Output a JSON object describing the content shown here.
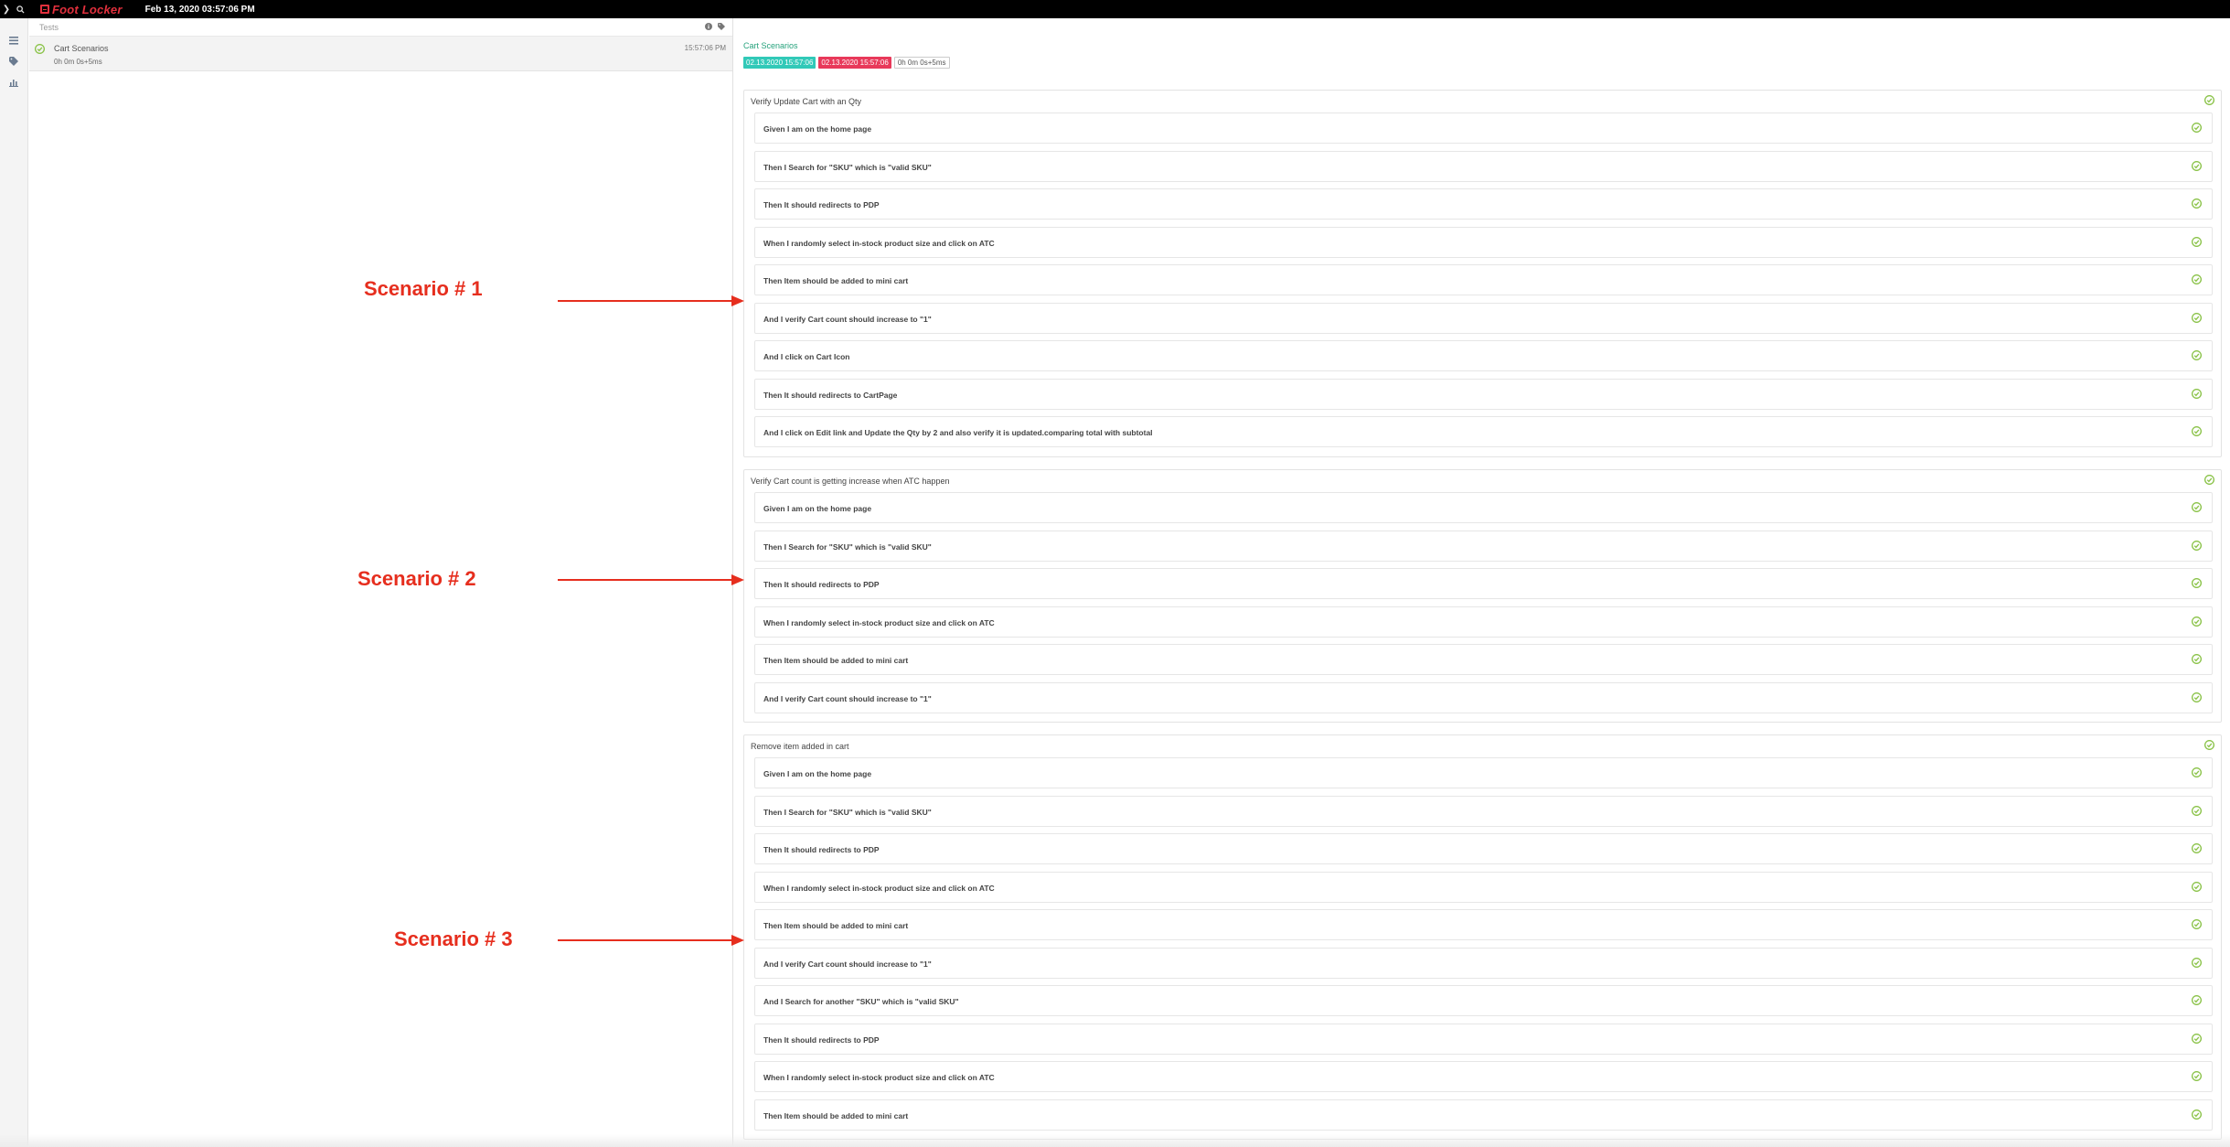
{
  "topbar": {
    "brand": "Foot Locker",
    "report_date": "Feb 13, 2020 03:57:06 PM",
    "icons": [
      "chevron-right-icon",
      "search-icon",
      "referee-shirt-logo-icon"
    ]
  },
  "leftnav": {
    "icons": [
      "list-icon",
      "tag-icon",
      "bar-chart-icon"
    ]
  },
  "tests": {
    "header_label": "Tests",
    "header_icons": [
      "info-icon",
      "tag-icon"
    ],
    "rows": [
      {
        "name": "Cart Scenarios",
        "duration": "0h 0m 0s+5ms",
        "time": "15:57:06 PM",
        "status": "pass"
      }
    ]
  },
  "detail": {
    "title": "Cart Scenarios",
    "start_badge": "02.13.2020 15:57:06",
    "end_badge": "02.13.2020 15:57:06",
    "duration_badge": "0h 0m 0s+5ms",
    "scenarios": [
      {
        "name": "Verify Update Cart with an Qty",
        "steps": [
          "Given I am on the home page",
          "Then I Search for \"SKU\" which is \"valid SKU\"",
          "Then It should redirects to PDP",
          "When I randomly select in-stock product size and click on ATC",
          "Then Item should be added to mini cart",
          "And I verify Cart count should increase to \"1\"",
          "And I click on Cart Icon",
          "Then It should redirects to CartPage",
          "And I click on Edit link and Update the Qty by 2 and also verify it is updated.comparing total with subtotal"
        ]
      },
      {
        "name": "Verify Cart count is getting increase when ATC happen",
        "steps": [
          "Given I am on the home page",
          "Then I Search for \"SKU\" which is \"valid SKU\"",
          "Then It should redirects to PDP",
          "When I randomly select in-stock product size and click on ATC",
          "Then Item should be added to mini cart",
          "And I verify Cart count should increase to \"1\""
        ]
      },
      {
        "name": "Remove item added in cart",
        "steps": [
          "Given I am on the home page",
          "Then I Search for \"SKU\" which is \"valid SKU\"",
          "Then It should redirects to PDP",
          "When I randomly select in-stock product size and click on ATC",
          "Then Item should be added to mini cart",
          "And I verify Cart count should increase to \"1\"",
          "And I Search for another \"SKU\" which is \"valid SKU\"",
          "Then It should redirects to PDP",
          "When I randomly select in-stock product size and click on ATC",
          "Then Item should be added to mini cart"
        ]
      }
    ]
  },
  "annotations": [
    {
      "label": "Scenario # 1"
    },
    {
      "label": "Scenario # 2"
    },
    {
      "label": "Scenario # 3"
    }
  ],
  "colors": {
    "brand": "#e2303d",
    "pass": "#8bc34a",
    "start_badge": "#31c9b8",
    "end_badge": "#e8395a",
    "title": "#26a27c",
    "annotation": "#e62e1e"
  }
}
